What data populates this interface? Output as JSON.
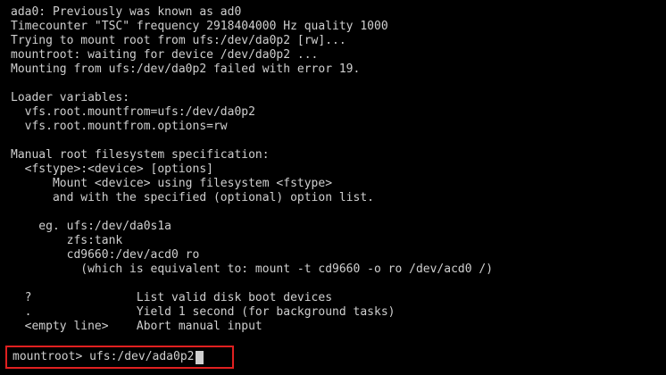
{
  "console": {
    "lines": [
      "ada0: Previously was known as ad0",
      "Timecounter \"TSC\" frequency 2918404000 Hz quality 1000",
      "Trying to mount root from ufs:/dev/da0p2 [rw]...",
      "mountroot: waiting for device /dev/da0p2 ...",
      "Mounting from ufs:/dev/da0p2 failed with error 19.",
      "",
      "Loader variables:",
      "  vfs.root.mountfrom=ufs:/dev/da0p2",
      "  vfs.root.mountfrom.options=rw",
      "",
      "Manual root filesystem specification:",
      "  <fstype>:<device> [options]",
      "      Mount <device> using filesystem <fstype>",
      "      and with the specified (optional) option list.",
      "",
      "    eg. ufs:/dev/da0s1a",
      "        zfs:tank",
      "        cd9660:/dev/acd0 ro",
      "          (which is equivalent to: mount -t cd9660 -o ro /dev/acd0 /)",
      "",
      "  ?               List valid disk boot devices",
      "  .               Yield 1 second (for background tasks)",
      "  <empty line>    Abort manual input"
    ]
  },
  "prompt": {
    "label": "mountroot> ",
    "input_value": "ufs:/dev/ada0p2"
  },
  "colors": {
    "background": "#000000",
    "text": "#cfcfcf",
    "highlight_border": "#e02020"
  }
}
